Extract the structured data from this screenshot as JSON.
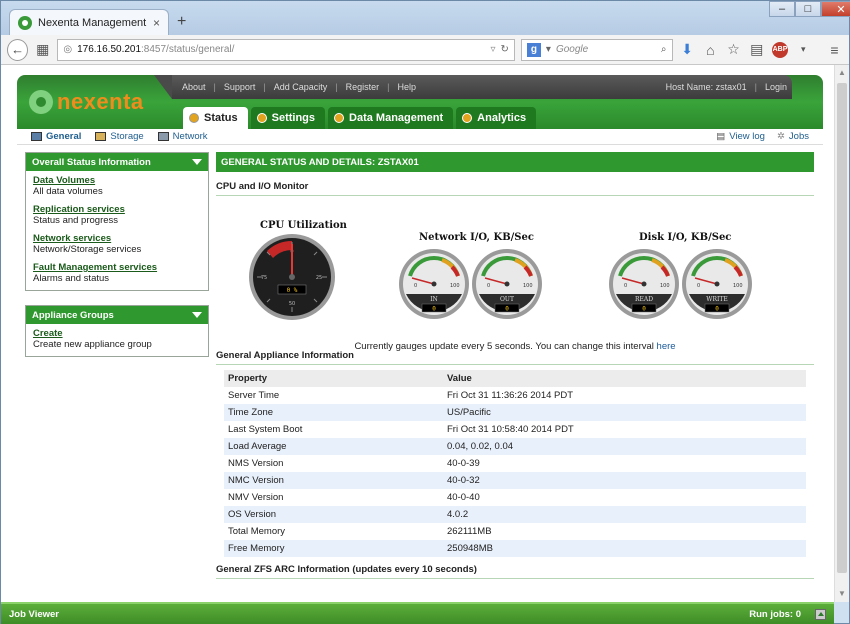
{
  "browser": {
    "tab_title": "Nexenta Management Vie...",
    "tab_close": "×",
    "new_tab": "+",
    "url_host": "176.16.50.201",
    "url_path": ":8457/status/general/",
    "search_placeholder": "Google"
  },
  "header": {
    "logo_text": "nexenta",
    "links": [
      "About",
      "Support",
      "Add Capacity",
      "Register",
      "Help"
    ],
    "host_label": "Host Name: zstax01",
    "login": "Login"
  },
  "main_tabs": [
    "Status",
    "Settings",
    "Data Management",
    "Analytics"
  ],
  "sub_nav": {
    "left": [
      "General",
      "Storage",
      "Network"
    ],
    "right": [
      "View log",
      "Jobs"
    ]
  },
  "sidebar": {
    "overall": {
      "title": "Overall Status Information",
      "items": [
        {
          "link": "Data Volumes",
          "desc": "All data volumes"
        },
        {
          "link": "Replication services",
          "desc": "Status and progress"
        },
        {
          "link": "Network services",
          "desc": "Network/Storage services"
        },
        {
          "link": "Fault Management services",
          "desc": "Alarms and status"
        }
      ]
    },
    "groups": {
      "title": "Appliance Groups",
      "items": [
        {
          "link": "Create",
          "desc": "Create new appliance group"
        }
      ]
    }
  },
  "content": {
    "bar_title": "GENERAL STATUS AND DETAILS: ZSTAX01",
    "monitor_title": "CPU and I/O Monitor",
    "gauges": {
      "cpu_title": "CPU Utilization",
      "cpu_value": "0 %",
      "cpu_percent": 0,
      "cpu_ticks": [
        "0",
        "25",
        "50",
        "75"
      ],
      "net_title": "Network I/O, KB/Sec",
      "disk_title": "Disk I/O, KB/Sec",
      "small": [
        {
          "label": "IN",
          "value": "0",
          "min": "0",
          "max": "100"
        },
        {
          "label": "OUT",
          "value": "0",
          "min": "0",
          "max": "100"
        },
        {
          "label": "READ",
          "value": "0",
          "min": "0",
          "max": "100"
        },
        {
          "label": "WRITE",
          "value": "0",
          "min": "0",
          "max": "100"
        }
      ]
    },
    "note_prefix": "Currently gauges update every 5 seconds. You can change this interval ",
    "note_link": "here",
    "appliance_title": "General Appliance Information",
    "table": {
      "headers": [
        "Property",
        "Value"
      ],
      "rows": [
        [
          "Server Time",
          "Fri Oct 31 11:36:26 2014 PDT"
        ],
        [
          "Time Zone",
          "US/Pacific"
        ],
        [
          "Last System Boot",
          "Fri Oct 31 10:58:40 2014 PDT"
        ],
        [
          "Load Average",
          "0.04, 0.02, 0.04"
        ],
        [
          "NMS Version",
          "40-0-39"
        ],
        [
          "NMC Version",
          "40-0-32"
        ],
        [
          "NMV Version",
          "40-0-40"
        ],
        [
          "OS Version",
          "4.0.2"
        ],
        [
          "Total Memory",
          "262111MB"
        ],
        [
          "Free Memory",
          "250948MB"
        ]
      ]
    },
    "zfs_title": "General ZFS ARC Information (updates every 10 seconds)"
  },
  "job_viewer": {
    "title": "Job Viewer",
    "run_jobs": "Run jobs: 0"
  },
  "colors": {
    "brand_green": "#2f982f",
    "logo_orange": "#f08c1c"
  }
}
